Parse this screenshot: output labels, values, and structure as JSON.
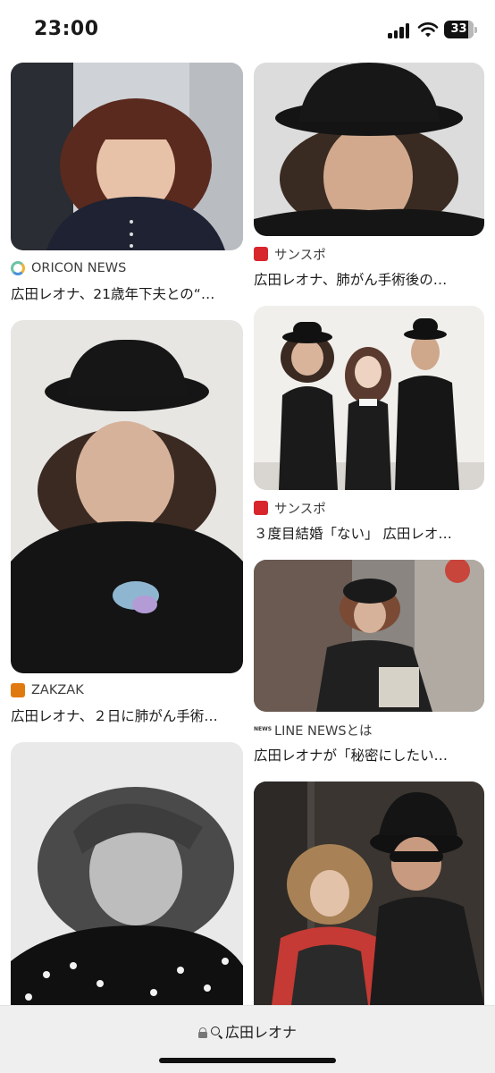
{
  "status_bar": {
    "time": "23:00",
    "battery": "33"
  },
  "results": [
    {
      "source": "ORICON NEWS",
      "source_icon": "oricon-logo-icon",
      "caption": "広田レオナ、21歳年下夫との“…"
    },
    {
      "source": "サンスポ",
      "source_icon": "sanspo-logo-icon",
      "caption": "広田レオナ、肺がん手術後の…"
    },
    {
      "source": "ZAKZAK",
      "source_icon": "zakzak-logo-icon",
      "caption": "広田レオナ、２日に肺がん手術…"
    },
    {
      "source": "サンスポ",
      "source_icon": "sanspo-logo-icon",
      "caption": "３度目結婚「ない」 広田レオ…"
    },
    {
      "source": "LINE NEWSとは",
      "source_icon": "line-news-logo-icon",
      "caption": "広田レオナが「秘密にしたい…"
    },
    {
      "source": "",
      "source_icon": "",
      "caption": ""
    },
    {
      "source": "",
      "source_icon": "",
      "caption": ""
    }
  ],
  "address_bar": {
    "query": "広田レオナ"
  },
  "colors": {
    "sanspo_red": "#d8262d",
    "zakzak_orange": "#e07a10",
    "bottom_bar": "#efefef"
  }
}
